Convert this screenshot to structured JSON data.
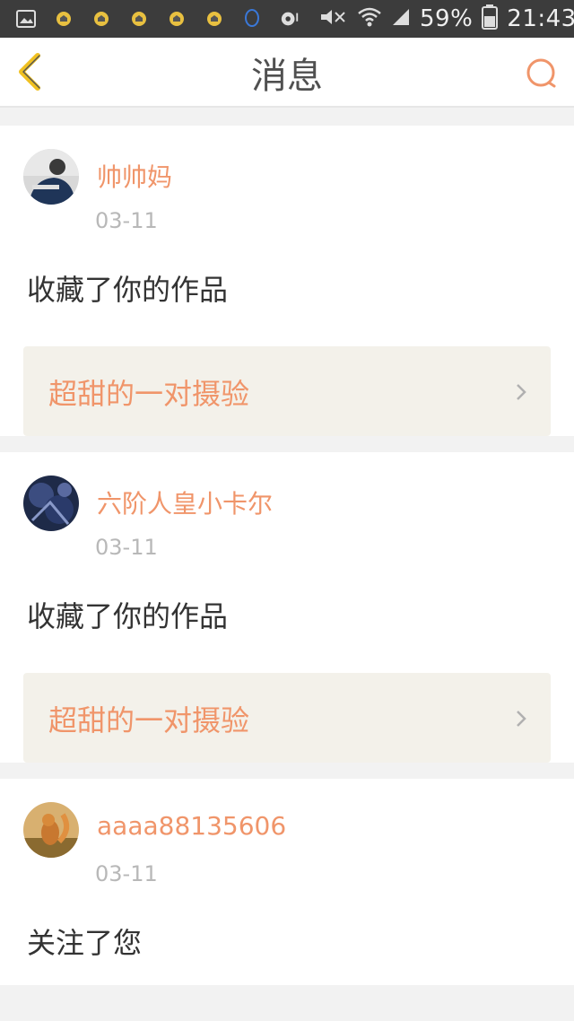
{
  "status_bar": {
    "battery": "59%",
    "time": "21:43",
    "left_icons": [
      "gallery-icon",
      "mail-icon",
      "mail-icon",
      "mail-icon",
      "mail-icon",
      "mail-icon",
      "qq-icon",
      "music-icon"
    ],
    "right_icons": [
      "mute-icon",
      "wifi-icon",
      "signal-icon",
      "battery-icon"
    ]
  },
  "header": {
    "title": "消息"
  },
  "colors": {
    "accent": "#f0956a",
    "back_arrow": "#f0c020",
    "search": "#f0956a"
  },
  "messages": [
    {
      "username": "帅帅妈",
      "date": "03-11",
      "action": "收藏了你的作品",
      "work_title": "超甜的一对摄验",
      "avatar": "avatar-photo-person"
    },
    {
      "username": "六阶人皇小卡尔",
      "date": "03-11",
      "action": "收藏了你的作品",
      "work_title": "超甜的一对摄验",
      "avatar": "avatar-photo-dark"
    },
    {
      "username": "aaaa88135606",
      "date": "03-11",
      "action": "关注了您",
      "avatar": "avatar-photo-squirrel"
    }
  ]
}
